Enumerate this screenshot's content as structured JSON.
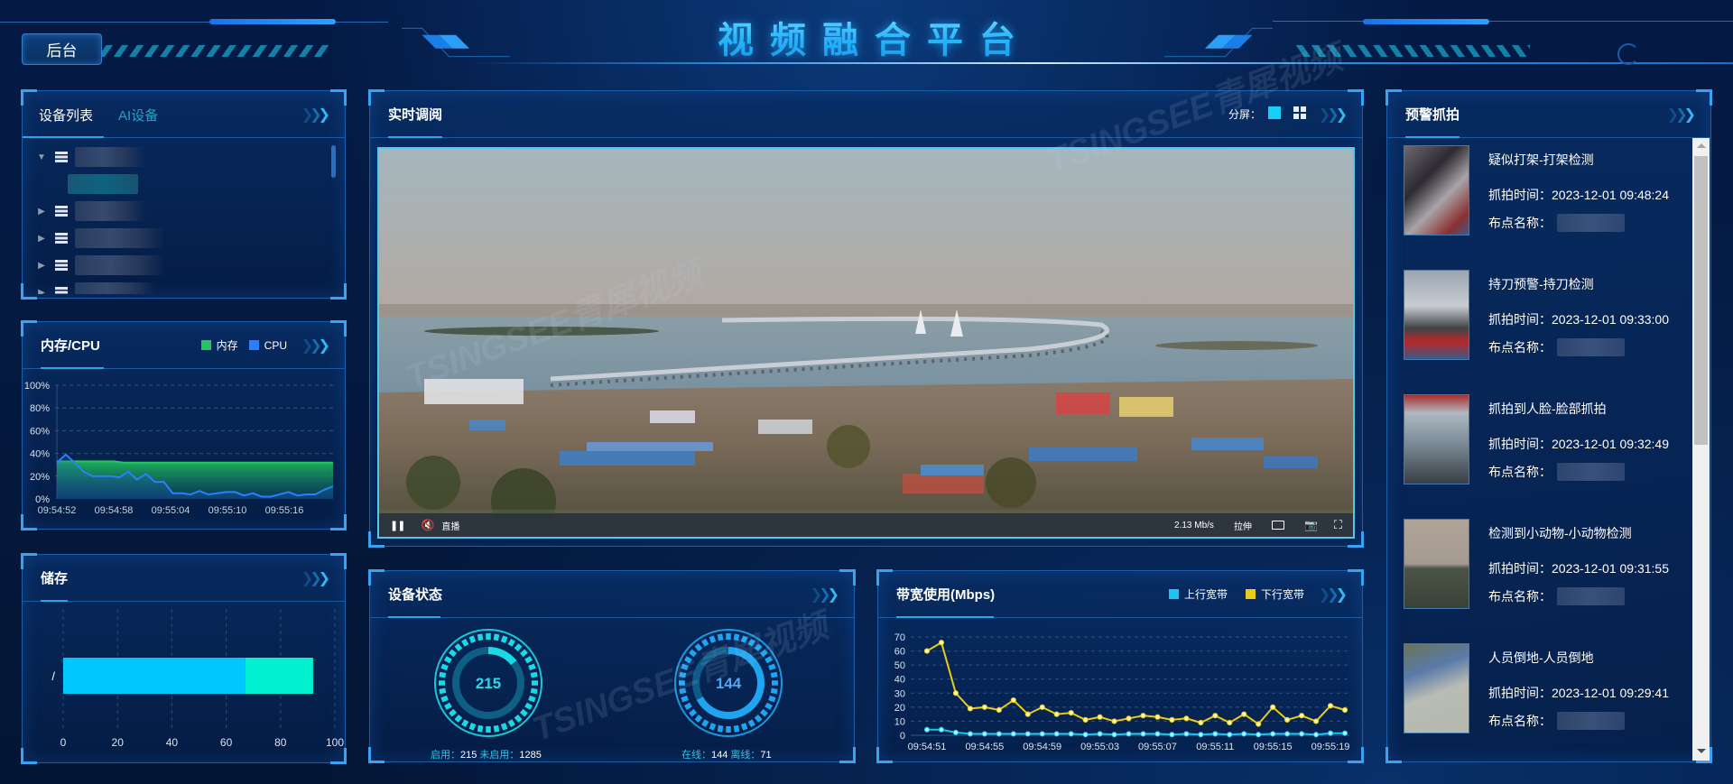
{
  "header": {
    "title": "视频融合平台",
    "back_button": "后台"
  },
  "device_panel": {
    "tabs": [
      "设备列表",
      "AI设备"
    ],
    "active_tab": "设备列表",
    "tree": [
      {
        "expanded": true,
        "label": "[redacted]"
      },
      {
        "child": true,
        "label": "[redacted]"
      },
      {
        "expanded": false,
        "label": "[redacted]"
      },
      {
        "expanded": false,
        "label": "[redacted]"
      },
      {
        "expanded": false,
        "label": "[redacted]"
      },
      {
        "expanded": false,
        "label": "[redacted]"
      }
    ]
  },
  "cpu_panel": {
    "title": "内存/CPU",
    "legend": [
      {
        "name": "内存",
        "color": "#22c55e"
      },
      {
        "name": "CPU",
        "color": "#2a7fff"
      }
    ]
  },
  "storage_panel": {
    "title": "储存"
  },
  "live_panel": {
    "title": "实时调阅",
    "split_label": "分屏：",
    "split_modes": [
      "single",
      "quad"
    ],
    "active_split": "single",
    "video": {
      "mode_label": "直播",
      "bitrate": "2.13 Mb/s",
      "stretch_label": "拉伸"
    }
  },
  "device_status": {
    "title": "设备状态",
    "gauges": [
      {
        "value": "215",
        "fraction": 0.143,
        "color": "#19d9e6",
        "track": "#0f5f85",
        "labels": [
          {
            "k": "启用：",
            "v": "215"
          },
          {
            "k": "未启用：",
            "v": "1285"
          }
        ]
      },
      {
        "value": "144",
        "fraction": 0.67,
        "color": "#1ea4f0",
        "track": "#0f5a8a",
        "labels": [
          {
            "k": "在线：",
            "v": "144"
          },
          {
            "k": "离线：",
            "v": "71"
          }
        ]
      }
    ]
  },
  "bandwidth_panel": {
    "title": "带宽使用(Mbps)",
    "legend": [
      {
        "name": "上行宽带",
        "color": "#17c7f2"
      },
      {
        "name": "下行宽带",
        "color": "#e9cc17"
      }
    ]
  },
  "alerts": {
    "title": "预警抓拍",
    "items": [
      {
        "title": "疑似打架-打架检测",
        "time_label": "抓拍时间：",
        "time": "2023-12-01 09:48:24",
        "site_label": "布点名称：",
        "thumb": "fight"
      },
      {
        "title": "持刀预警-持刀检测",
        "time_label": "抓拍时间：",
        "time": "2023-12-01 09:33:00",
        "site_label": "布点名称：",
        "thumb": "knife"
      },
      {
        "title": "抓拍到人脸-脸部抓拍",
        "time_label": "抓拍时间：",
        "time": "2023-12-01 09:32:49",
        "site_label": "布点名称：",
        "thumb": "face"
      },
      {
        "title": "检测到小动物-小动物检测",
        "time_label": "抓拍时间：",
        "time": "2023-12-01 09:31:55",
        "site_label": "布点名称：",
        "thumb": "animal"
      },
      {
        "title": "人员倒地-人员倒地",
        "time_label": "抓拍时间：",
        "time": "2023-12-01 09:29:41",
        "site_label": "布点名称：",
        "thumb": "fall"
      }
    ]
  },
  "watermark": "TSINGSEE青犀视频",
  "chart_data": [
    {
      "id": "cpu_mem",
      "type": "area",
      "title": "内存/CPU",
      "xlabel": "",
      "ylabel": "",
      "ylim": [
        0,
        100
      ],
      "yticks": [
        "0%",
        "20%",
        "40%",
        "60%",
        "80%",
        "100%"
      ],
      "x_tick_labels": [
        "09:54:52",
        "09:54:58",
        "09:55:04",
        "09:55:10",
        "09:55:16"
      ],
      "grid": true,
      "legend": "top-right",
      "series": [
        {
          "name": "内存",
          "color": "#22c55e",
          "values": [
            33,
            33,
            33,
            33,
            33,
            33,
            33,
            32,
            32,
            32,
            32,
            32,
            32,
            32,
            32,
            32,
            32,
            32,
            32,
            32,
            32,
            32,
            32,
            32,
            32,
            32,
            32,
            32,
            32,
            32
          ]
        },
        {
          "name": "CPU",
          "color": "#2a7fff",
          "values": [
            32,
            39,
            32,
            24,
            20,
            20,
            20,
            19,
            24,
            17,
            22,
            15,
            15,
            5,
            5,
            4,
            7,
            4,
            5,
            6,
            6,
            3,
            5,
            2,
            2,
            4,
            6,
            3,
            4,
            4,
            8,
            11
          ]
        }
      ]
    },
    {
      "id": "storage",
      "type": "bar",
      "title": "储存",
      "orientation": "horizontal",
      "categories": [
        "/"
      ],
      "xlim": [
        0,
        100
      ],
      "x_ticks": [
        0,
        20,
        40,
        60,
        80,
        100
      ],
      "grid": true,
      "series": [
        {
          "name": "used",
          "color": "#00c8ff",
          "values": [
            67
          ]
        },
        {
          "name": "free",
          "color": "#00f0d0",
          "values": [
            25
          ]
        }
      ]
    },
    {
      "id": "bandwidth",
      "type": "line",
      "title": "带宽使用(Mbps)",
      "ylim": [
        0,
        70
      ],
      "yticks": [
        0,
        10,
        20,
        30,
        40,
        50,
        60,
        70
      ],
      "x_tick_labels": [
        "09:54:51",
        "09:54:55",
        "09:54:59",
        "09:55:03",
        "09:55:07",
        "09:55:11",
        "09:55:15",
        "09:55:19"
      ],
      "grid": true,
      "legend": "top-right",
      "series": [
        {
          "name": "上行宽带",
          "color": "#17c7f2",
          "values": [
            4,
            4,
            2,
            1,
            1,
            1,
            1,
            1,
            1,
            1,
            1,
            0.5,
            1,
            0.5,
            1,
            1,
            1,
            0.5,
            1,
            0.5,
            1,
            0.5,
            1,
            0.5,
            1,
            1,
            1,
            0.5,
            1.5,
            1.5
          ]
        },
        {
          "name": "下行宽带",
          "color": "#e9cc17",
          "values": [
            60,
            66,
            30,
            19,
            20,
            18,
            25,
            15,
            20,
            15,
            16,
            11,
            13,
            10,
            12,
            14,
            13,
            11,
            12,
            9,
            14,
            9,
            15,
            8,
            20,
            11,
            14,
            10,
            21,
            18
          ]
        }
      ]
    }
  ]
}
